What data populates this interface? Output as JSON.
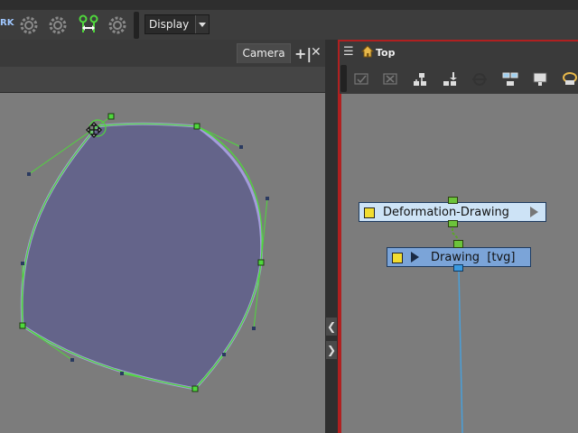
{
  "toolbar": {
    "tool_label": "RK",
    "icons": [
      "gear-icon",
      "gear-icon",
      "gear-icon",
      "pivot-icon",
      "gear-icon"
    ],
    "display_select": {
      "value": "Display"
    }
  },
  "camera_panel": {
    "tab_label": "Camera",
    "add_symbol": "+|",
    "close_symbol": "✕",
    "collapse_left": "❮",
    "expand_right": "❯"
  },
  "node_view": {
    "menu_symbol": "☰",
    "title": "Top",
    "toolbar_icons": [
      "enable-icon",
      "disable-icon",
      "add-peg-icon",
      "peg-down-icon",
      "focus-icon",
      "group-icon",
      "display-icon",
      "wand-icon"
    ],
    "nodes": [
      {
        "label": "Deformation-Drawing",
        "color": "#cde3f6"
      },
      {
        "label": "Drawing  [tvg]",
        "color": "#7ba4d8"
      }
    ]
  },
  "colors": {
    "shape_fill": "#64648a",
    "curve": "#4fd83c",
    "selected_edge": "#a39cdb",
    "node_frame": "#b02020"
  }
}
